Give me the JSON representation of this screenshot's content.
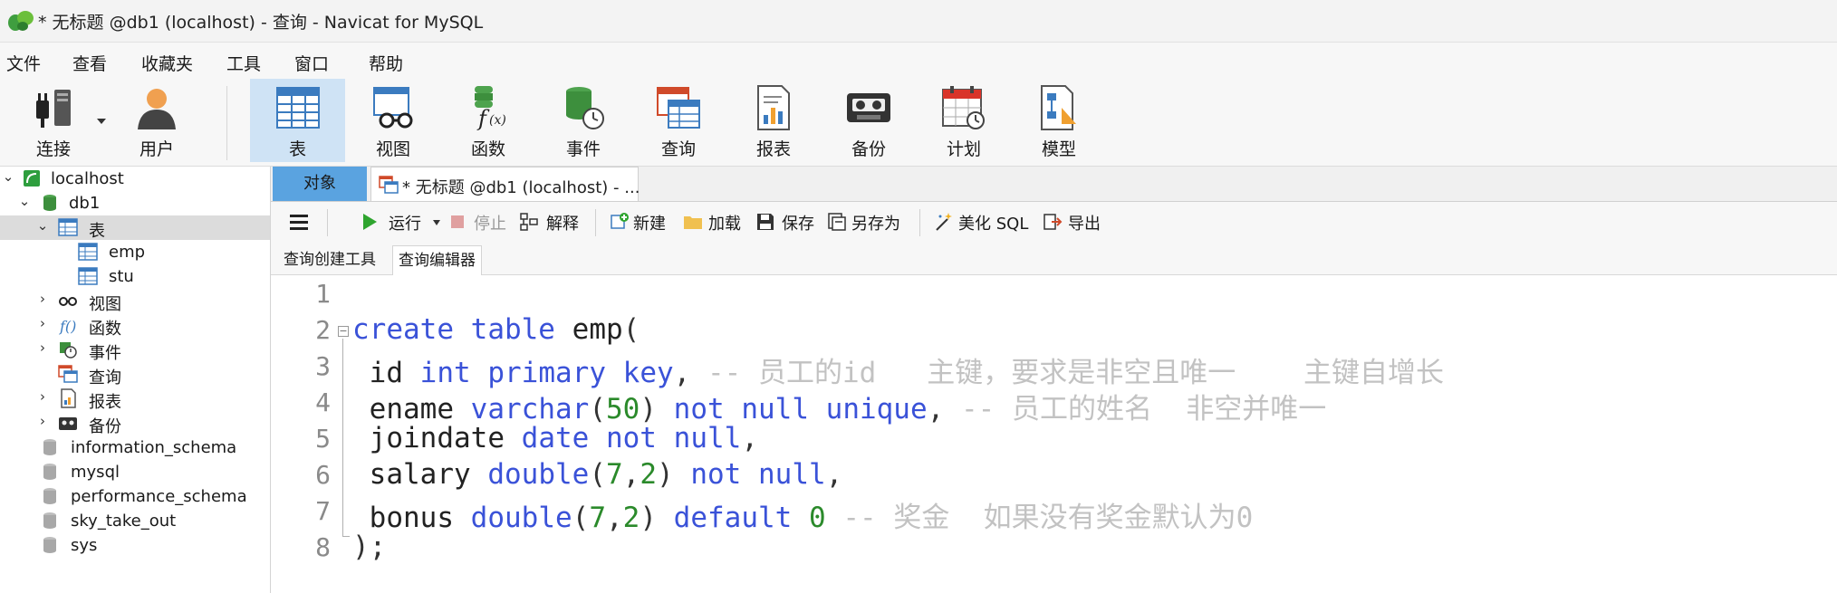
{
  "window": {
    "title": "* 无标题 @db1 (localhost) - 查询 - Navicat for MySQL"
  },
  "menu": [
    "文件",
    "查看",
    "收藏夹",
    "工具",
    "窗口",
    "帮助"
  ],
  "toolbar": {
    "connect": "连接",
    "user": "用户",
    "table": "表",
    "view": "视图",
    "function": "函数",
    "event": "事件",
    "query": "查询",
    "report": "报表",
    "backup": "备份",
    "schedule": "计划",
    "model": "模型"
  },
  "sidebar": {
    "connection": "localhost",
    "database": "db1",
    "tables_node": "表",
    "tables": [
      "emp",
      "stu"
    ],
    "nodes": [
      "视图",
      "函数",
      "事件",
      "查询",
      "报表",
      "备份"
    ],
    "other_databases": [
      "information_schema",
      "mysql",
      "performance_schema",
      "sky_take_out",
      "sys"
    ]
  },
  "tabs": {
    "objects": "对象",
    "query_tab": "* 无标题 @db1 (localhost) - ..."
  },
  "query_toolbar": {
    "run": "运行",
    "stop": "停止",
    "explain": "解释",
    "new": "新建",
    "load": "加载",
    "save": "保存",
    "save_as": "另存为",
    "beautify": "美化 SQL",
    "export": "导出"
  },
  "subtabs": {
    "builder": "查询创建工具",
    "editor": "查询编辑器"
  },
  "editor": {
    "line_numbers": [
      "1",
      "2",
      "3",
      "4",
      "5",
      "6",
      "7",
      "8"
    ],
    "lines": [
      "",
      "create table emp(",
      " id int primary key, -- 员工的id   主键，要求是非空且唯一    主键自增长",
      " ename varchar(50) not null unique, -- 员工的姓名  非空并唯一",
      " joindate date not null,",
      " salary double(7,2) not null,",
      " bonus double(7,2) default 0 -- 奖金  如果没有奖金默认为0",
      ");"
    ]
  },
  "colors": {
    "keyword": "#3a52d8",
    "number": "#2b8a2b",
    "comment": "#c2c2c2",
    "active_tab": "#5aa3e0",
    "active_toolbar": "#cfe3f5"
  }
}
